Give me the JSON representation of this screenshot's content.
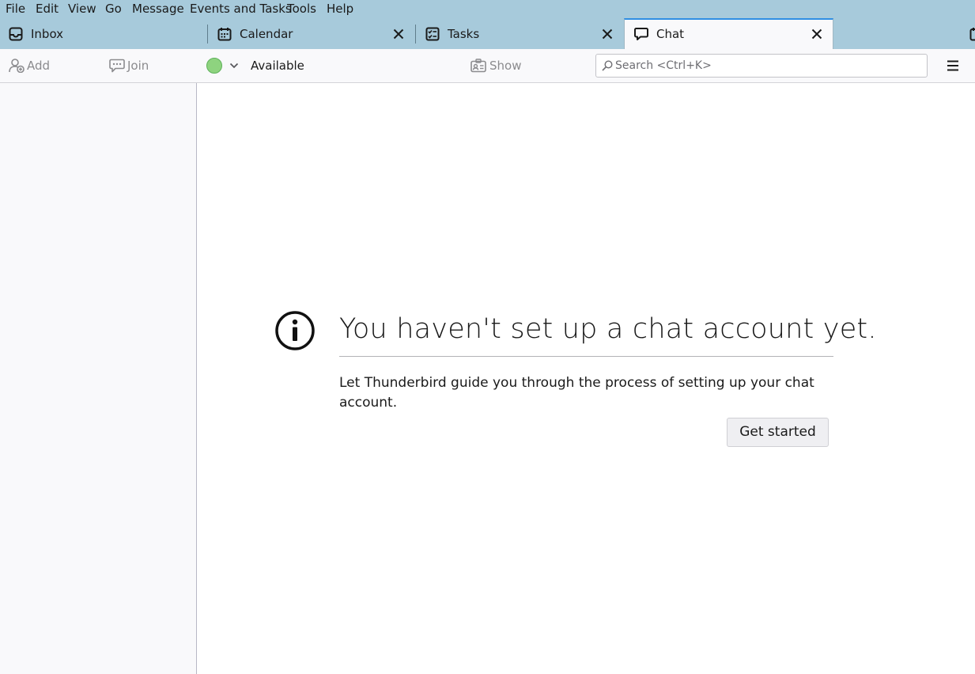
{
  "menubar": {
    "items": [
      {
        "label": "File",
        "key": "file"
      },
      {
        "label": "Edit",
        "key": "edit"
      },
      {
        "label": "View",
        "key": "view"
      },
      {
        "label": "Go",
        "key": "go"
      },
      {
        "label": "Message",
        "key": "message"
      },
      {
        "label": "Events and Tasks",
        "key": "events-and-tasks"
      },
      {
        "label": "Tools",
        "key": "tools"
      },
      {
        "label": "Help",
        "key": "help"
      }
    ]
  },
  "tabs": [
    {
      "label": "Inbox",
      "icon": "inbox-icon",
      "closable": false,
      "selected": false
    },
    {
      "label": "Calendar",
      "icon": "calendar-icon",
      "closable": true,
      "selected": false
    },
    {
      "label": "Tasks",
      "icon": "tasks-icon",
      "closable": true,
      "selected": false
    },
    {
      "label": "Chat",
      "icon": "chat-icon",
      "closable": true,
      "selected": true
    }
  ],
  "toolbar": {
    "add_contact": "Add Contact",
    "join_chat": "Join Chat",
    "status": "Available",
    "show_accounts": "Show Accounts",
    "search_placeholder": "Search <Ctrl+K>"
  },
  "main": {
    "heading": "You haven't set up a chat account yet.",
    "description": "Let Thunderbird guide you through the process of setting up your chat account.",
    "button": "Get started"
  },
  "colors": {
    "tabstrip": "#a7cadb",
    "selected_tab_accent": "#2f8ee3",
    "status_available": "#8ed37f"
  }
}
